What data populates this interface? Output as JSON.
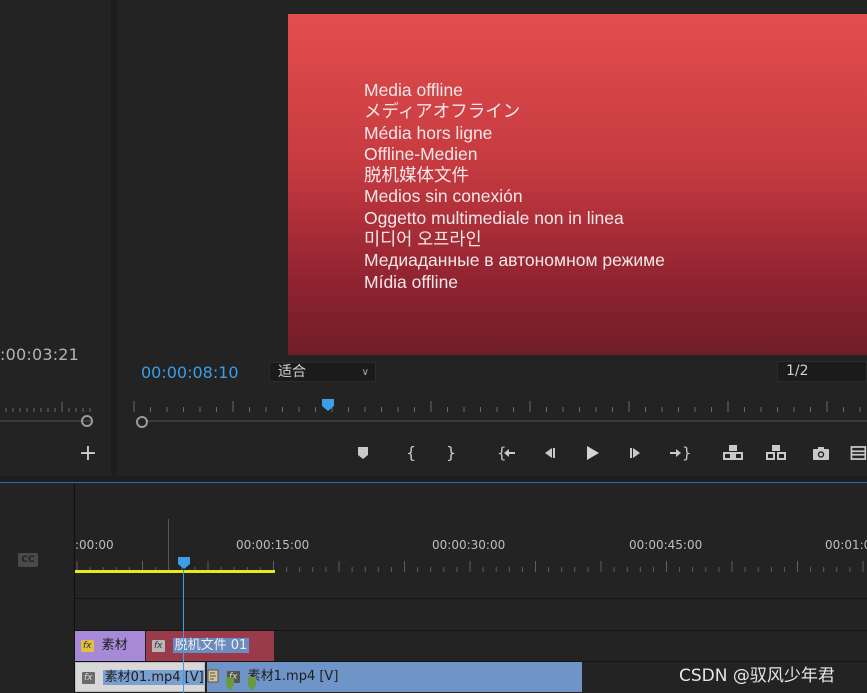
{
  "source_monitor": {
    "timecode": ":00:03:21"
  },
  "program_monitor": {
    "offline_lines": [
      "Media offline",
      "メディアオフライン",
      "Média hors ligne",
      "Offline-Medien",
      "脱机媒体文件",
      "Medios sin conexión",
      "Oggetto multimediale non in linea",
      "미디어 오프라인",
      "Медиаданные в автономном режиме",
      "Mídia offline"
    ],
    "timecode": "00:00:08:10",
    "fit_label": "适合",
    "resolution_label": "1/2",
    "frame_colors": {
      "top": "#e24e4e",
      "bottom": "#6e1e28"
    },
    "controls": [
      "add-marker-icon",
      "mark-in-icon",
      "mark-out-icon",
      "go-to-in-icon",
      "step-back-icon",
      "play-icon",
      "step-forward-icon",
      "go-to-out-icon",
      "lift-icon",
      "extract-icon",
      "export-frame-icon",
      "insert-icon"
    ]
  },
  "timeline": {
    "cc_label": "CC",
    "ruler_labels": [
      ":00:00",
      "00:00:15:00",
      "00:00:30:00",
      "00:00:45:00",
      "00:01:0"
    ],
    "clips_top": [
      {
        "fx": "fx",
        "label": "素材"
      },
      {
        "fx": "fx",
        "label": "脱机文件 01"
      }
    ],
    "clips_bottom": [
      {
        "fx": "fx",
        "label": "素材01.mp4 [V]"
      },
      {
        "fx": "fx",
        "label": "素材1.mp4 [V]"
      }
    ],
    "accent_color": "#3c9ee8",
    "work_area_color": "#e8e820"
  },
  "watermark": "CSDN @驭风少年君"
}
